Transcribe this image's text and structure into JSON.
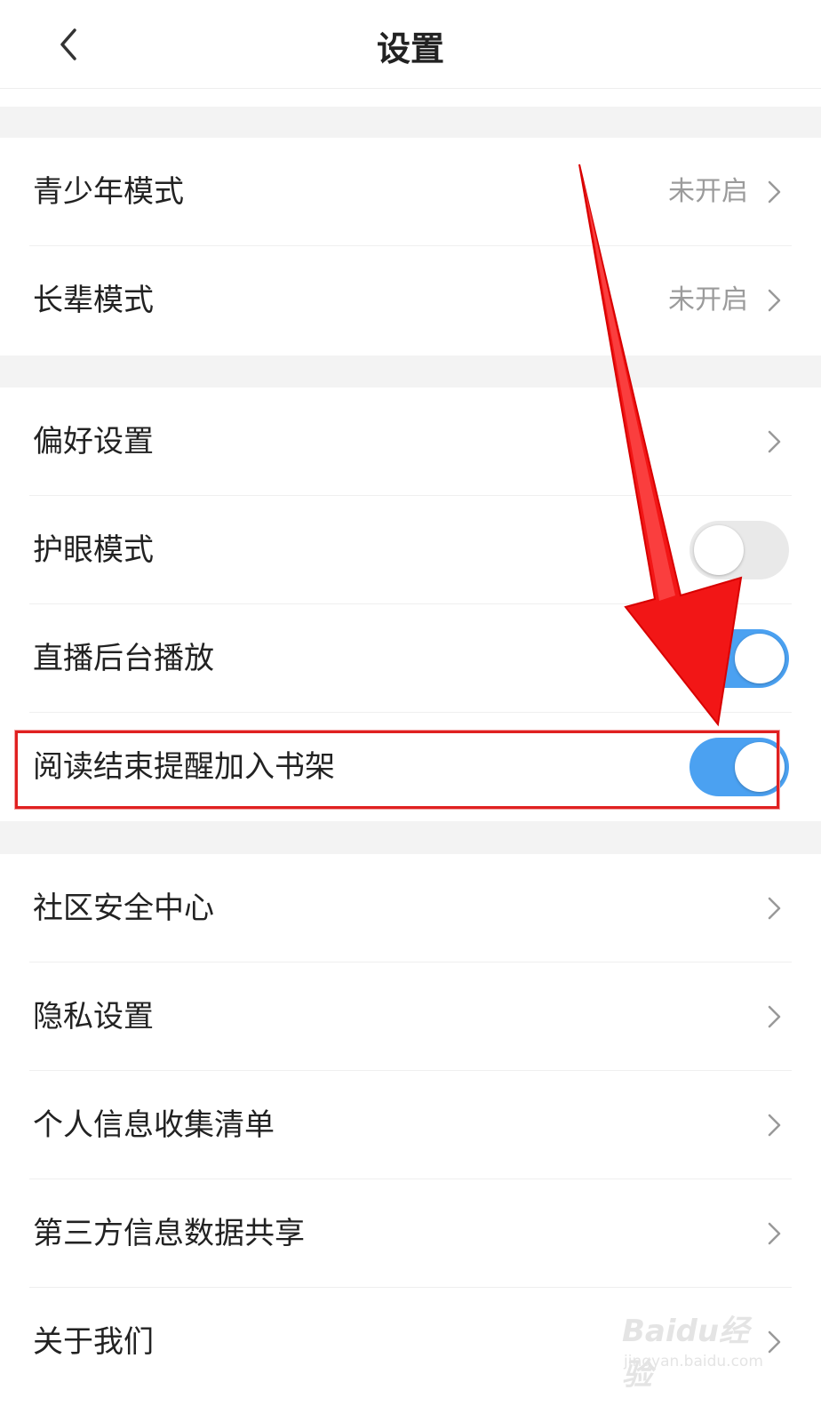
{
  "header": {
    "title": "设置",
    "back_icon": "chevron-left-icon"
  },
  "sections": [
    {
      "items": [
        {
          "label": "青少年模式",
          "value": "未开启",
          "type": "link"
        },
        {
          "label": "长辈模式",
          "value": "未开启",
          "type": "link"
        }
      ]
    },
    {
      "items": [
        {
          "label": "偏好设置",
          "type": "link"
        },
        {
          "label": "护眼模式",
          "type": "toggle",
          "on": false
        },
        {
          "label": "直播后台播放",
          "type": "toggle",
          "on": true
        },
        {
          "label": "阅读结束提醒加入书架",
          "type": "toggle",
          "on": true,
          "highlighted": true
        }
      ]
    },
    {
      "items": [
        {
          "label": "社区安全中心",
          "type": "link"
        },
        {
          "label": "隐私设置",
          "type": "link"
        },
        {
          "label": "个人信息收集清单",
          "type": "link"
        },
        {
          "label": "第三方信息数据共享",
          "type": "link"
        },
        {
          "label": "关于我们",
          "type": "link"
        }
      ]
    }
  ],
  "annotation": {
    "arrow_color": "#f21616",
    "highlight_color": "#e02020"
  },
  "watermark": {
    "brand": "Baidu经验",
    "sub": "jingyan.baidu.com"
  },
  "colors": {
    "toggle_on": "#4ba1f1",
    "toggle_off": "#e9e9e9",
    "section_gap": "#f3f3f3",
    "value_text": "#9b9b9b"
  }
}
